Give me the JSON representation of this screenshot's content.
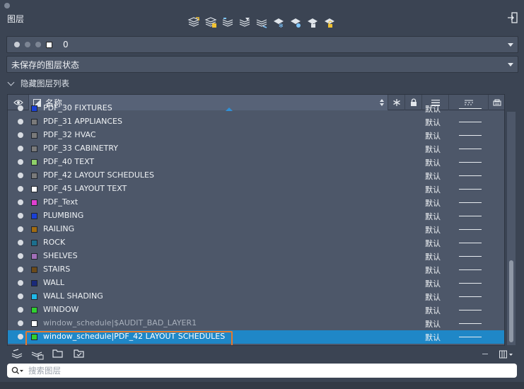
{
  "panel": {
    "title": "图层"
  },
  "toolbar": {
    "buttons": [
      {
        "icon": "new-layer-icon"
      },
      {
        "icon": "new-layer-vp-frozen-icon"
      },
      {
        "icon": "delete-layer-icon"
      },
      {
        "icon": "set-current-icon"
      },
      {
        "icon": "isolate-layer-icon"
      },
      {
        "icon": "freeze-layer-icon"
      },
      {
        "icon": "layer-off-icon"
      },
      {
        "icon": "lock-layer-icon"
      },
      {
        "icon": "unlock-layer-icon"
      }
    ],
    "exit_icon": "exit-panel-icon"
  },
  "current_layer": {
    "name": "0"
  },
  "layer_state": {
    "value": "未保存的图层状态"
  },
  "hidden_list": {
    "label": "隐藏图层列表"
  },
  "columns": {
    "name": "名称"
  },
  "layers": [
    {
      "name": "PDF_30 FIXTURES",
      "color": "#1a40d6",
      "lineweight": "默认",
      "xref": false
    },
    {
      "name": "PDF_31 APPLIANCES",
      "color": "#7a7a7a",
      "lineweight": "默认",
      "xref": false
    },
    {
      "name": "PDF_32 HVAC",
      "color": "#7a7a7a",
      "lineweight": "默认",
      "xref": false
    },
    {
      "name": "PDF_33 CABINETRY",
      "color": "#7a7a7a",
      "lineweight": "默认",
      "xref": false
    },
    {
      "name": "PDF_40 TEXT",
      "color": "#8fd06a",
      "lineweight": "默认",
      "xref": false
    },
    {
      "name": "PDF_42 LAYOUT SCHEDULES",
      "color": "#7a7a7a",
      "lineweight": "默认",
      "xref": false
    },
    {
      "name": "PDF_45 LAYOUT TEXT",
      "color": "#ffffff",
      "lineweight": "默认",
      "xref": false
    },
    {
      "name": "PDF_Text",
      "color": "#e040d0",
      "lineweight": "默认",
      "xref": false
    },
    {
      "name": "PLUMBING",
      "color": "#1a40d6",
      "lineweight": "默认",
      "xref": false
    },
    {
      "name": "RAILING",
      "color": "#a06b12",
      "lineweight": "默认",
      "xref": false
    },
    {
      "name": "ROCK",
      "color": "#1c6f8e",
      "lineweight": "默认",
      "xref": false
    },
    {
      "name": "SHELVES",
      "color": "#a16fb8",
      "lineweight": "默认",
      "xref": false
    },
    {
      "name": "STAIRS",
      "color": "#6b4a1a",
      "lineweight": "默认",
      "xref": false
    },
    {
      "name": "WALL",
      "color": "#1a2a7a",
      "lineweight": "默认",
      "xref": false
    },
    {
      "name": "WALL SHADING",
      "color": "#20b8e8",
      "lineweight": "默认",
      "xref": false
    },
    {
      "name": "WINDOW",
      "color": "#30d030",
      "lineweight": "默认",
      "xref": false
    },
    {
      "name": "window_schedule|$AUDIT_BAD_LAYER1",
      "color": "#ffffff",
      "lineweight": "默认",
      "xref": true
    },
    {
      "name": "window_schedule|PDF_42 LAYOUT SCHEDULES",
      "color": "#30d030",
      "lineweight": "默认",
      "xref": true,
      "selected": true
    }
  ],
  "bottom_toolbar": {
    "buttons": [
      {
        "icon": "layer-properties-icon"
      },
      {
        "icon": "layer-states-icon"
      },
      {
        "icon": "open-folder-icon"
      },
      {
        "icon": "save-folder-icon"
      }
    ],
    "view_icon": "view-options-icon"
  },
  "search": {
    "placeholder": "搜索图层"
  }
}
